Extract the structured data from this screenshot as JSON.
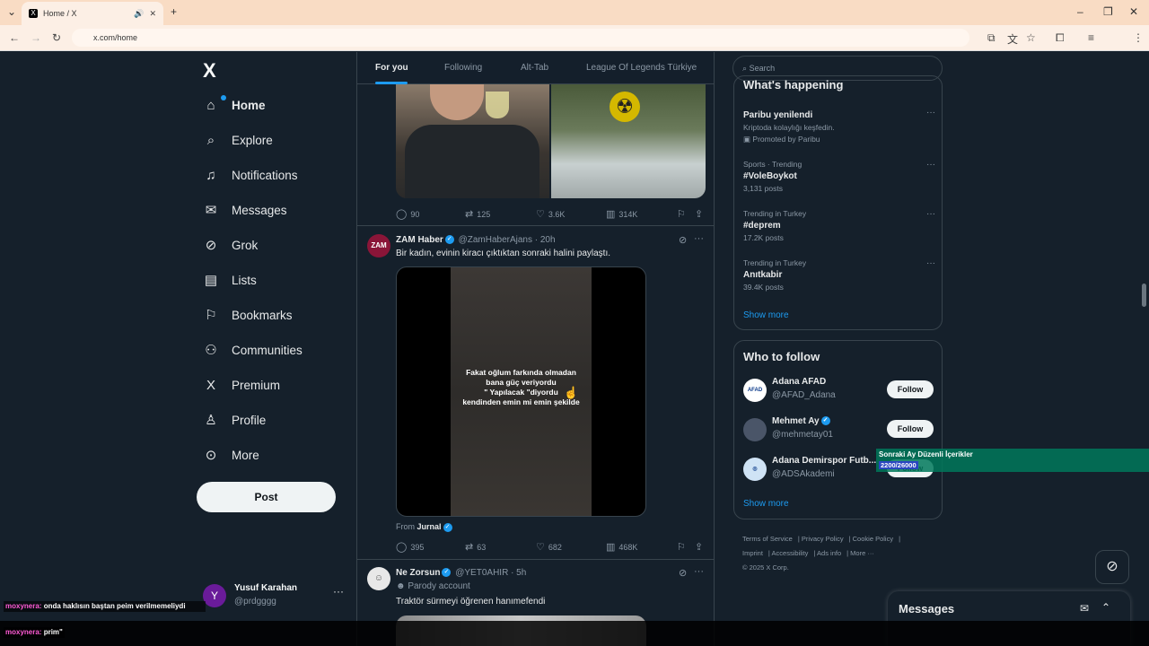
{
  "browser": {
    "tab_title": "Home / X",
    "url": "x.com/home"
  },
  "nav": {
    "logo": "X",
    "items": [
      {
        "label": "Home",
        "icon": "home-icon"
      },
      {
        "label": "Explore",
        "icon": "search-icon"
      },
      {
        "label": "Notifications",
        "icon": "bell-icon"
      },
      {
        "label": "Messages",
        "icon": "mail-icon"
      },
      {
        "label": "Grok",
        "icon": "grok-icon"
      },
      {
        "label": "Lists",
        "icon": "list-icon"
      },
      {
        "label": "Bookmarks",
        "icon": "bookmark-icon"
      },
      {
        "label": "Communities",
        "icon": "people-icon"
      },
      {
        "label": "Premium",
        "icon": "x-icon"
      },
      {
        "label": "Profile",
        "icon": "person-icon"
      },
      {
        "label": "More",
        "icon": "more-circle-icon"
      }
    ],
    "post_label": "Post"
  },
  "user": {
    "initial": "Y",
    "name": "Yusuf Karahan",
    "handle": "@prdgggg"
  },
  "feed": {
    "tabs": [
      "For you",
      "Following",
      "Alt-Tab",
      "League Of Legends Türkiye"
    ],
    "tweet1_actions": {
      "replies": "90",
      "reposts": "125",
      "likes": "3.6K",
      "views": "314K"
    },
    "tweet2": {
      "avatar_text": "ZAM",
      "name": "ZAM Haber",
      "handle": "@ZamHaberAjans",
      "time": "· 20h",
      "text": "Bir kadın, evinin kiracı çıktıktan sonraki halini paylaştı.",
      "video_caption_1": "Fakat oğlum farkında olmadan",
      "video_caption_2": "bana güç veriyordu",
      "video_caption_3": "\" Yapılacak \"diyordu",
      "video_caption_4": "kendinden emin mi emin şekilde",
      "from_label": "From",
      "from_source": "Jurnal",
      "replies": "395",
      "reposts": "63",
      "likes": "682",
      "views": "468K"
    },
    "tweet3": {
      "name": "Ne Zorsun",
      "handle": "@YET0AHIR",
      "time": "· 5h",
      "label": "Parody account",
      "text": "Traktör sürmeyi öğrenen hanımefendi"
    }
  },
  "sidebar": {
    "search_placeholder": "Search",
    "happening_title": "What's happening",
    "trends": [
      {
        "meta": "",
        "title": "Paribu yenilendi",
        "count": "Kriptoda kolaylığı keşfedin.",
        "extra": "Promoted by Paribu"
      },
      {
        "meta": "Sports · Trending",
        "title": "#VoleBoykot",
        "count": "3,131 posts"
      },
      {
        "meta": "Trending in Turkey",
        "title": "#deprem",
        "count": "17.2K posts"
      },
      {
        "meta": "Trending in Turkey",
        "title": "Anıtkabir",
        "count": "39.4K posts"
      }
    ],
    "show_more": "Show more",
    "wtf_title": "Who to follow",
    "who_to_follow": [
      {
        "name": "Adana AFAD",
        "handle": "@AFAD_Adana",
        "avatar": "AFAD"
      },
      {
        "name": "Mehmet Ay",
        "handle": "@mehmetay01",
        "avatar": ""
      },
      {
        "name": "Adana Demirspor Futb...",
        "handle": "@ADSAkademi",
        "avatar": ""
      }
    ],
    "follow_label": "Follow",
    "footer": [
      "Terms of Service",
      "Privacy Policy",
      "Cookie Policy",
      "Imprint",
      "Accessibility",
      "Ads info",
      "More ···",
      "© 2025 X Corp."
    ]
  },
  "messages_drawer": {
    "title": "Messages"
  },
  "overlay": {
    "banner_line1": "Sonraki Ay Düzenli İçerikler",
    "banner_line2": "2200/26000",
    "chat": [
      {
        "user": "moxynera:",
        "text": "onda haklısın baştan peim verilmemeliydi"
      },
      {
        "user": "moxynera:",
        "text": "prim\""
      }
    ]
  }
}
